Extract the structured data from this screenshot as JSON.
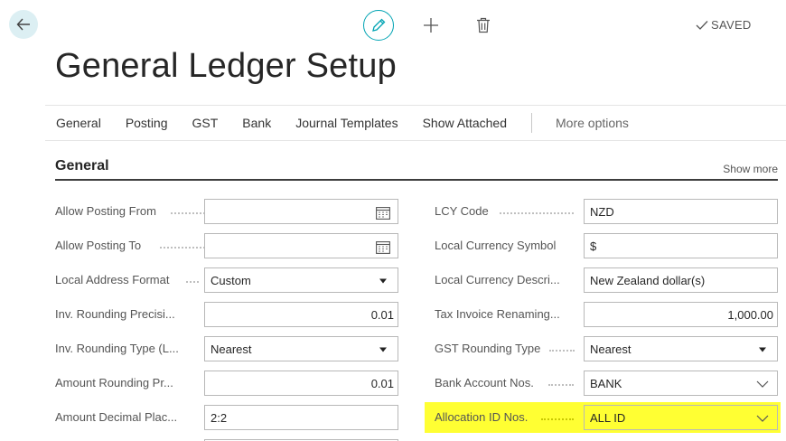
{
  "toolbar": {
    "back_icon": "arrow-left-icon",
    "edit_icon": "pencil-icon",
    "add_icon": "plus-icon",
    "delete_icon": "trash-icon",
    "saved_label": "SAVED",
    "accent_color": "#00a3b3"
  },
  "page": {
    "title": "General Ledger Setup"
  },
  "nav": {
    "items": [
      "General",
      "Posting",
      "GST",
      "Bank",
      "Journal Templates",
      "Show Attached"
    ],
    "more": "More options"
  },
  "section": {
    "title": "General",
    "show_more": "Show more"
  },
  "left_fields": [
    {
      "label": "Allow Posting From",
      "value": "",
      "type": "date"
    },
    {
      "label": "Allow Posting To",
      "value": "",
      "type": "date"
    },
    {
      "label": "Local Address Format",
      "value": "Custom",
      "type": "select"
    },
    {
      "label": "Inv. Rounding Precisi...",
      "value": "0.01",
      "type": "number"
    },
    {
      "label": "Inv. Rounding Type (L...",
      "value": "Nearest",
      "type": "select"
    },
    {
      "label": "Amount Rounding Pr...",
      "value": "0.01",
      "type": "number"
    },
    {
      "label": "Amount Decimal Plac...",
      "value": "2:2",
      "type": "text"
    }
  ],
  "right_fields": [
    {
      "label": "LCY Code",
      "value": "NZD",
      "type": "text"
    },
    {
      "label": "Local Currency Symbol",
      "value": "$",
      "type": "text"
    },
    {
      "label": "Local Currency Descri...",
      "value": "New Zealand dollar(s)",
      "type": "text"
    },
    {
      "label": "Tax Invoice Renaming...",
      "value": "1,000.00",
      "type": "number"
    },
    {
      "label": "GST Rounding Type",
      "value": "Nearest",
      "type": "select"
    },
    {
      "label": "Bank Account Nos.",
      "value": "BANK",
      "type": "lookup"
    },
    {
      "label": "Allocation ID Nos.",
      "value": "ALL ID",
      "type": "lookup",
      "highlighted": true
    }
  ],
  "highlight_color": "#ffff33"
}
